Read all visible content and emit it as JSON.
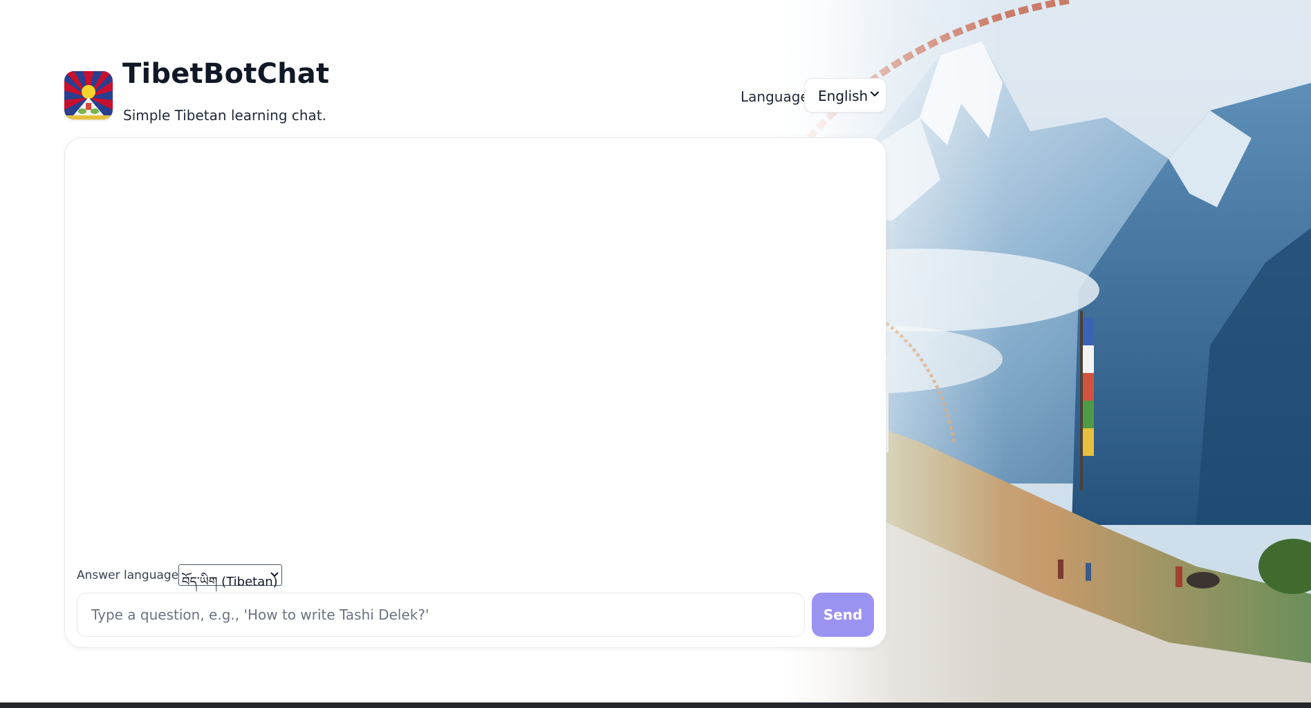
{
  "header": {
    "title": "TibetBotChat",
    "subtitle": "Simple Tibetan learning chat.",
    "logo_icon": "tibetan-flag-icon"
  },
  "language_switch": {
    "label": "Language:",
    "selected": "English"
  },
  "chat": {
    "messages": [],
    "answer_language": {
      "label": "Answer language:",
      "selected": "བོད་ཡིག (Tibetan)"
    },
    "input": {
      "value": "",
      "placeholder": "Type a question, e.g., 'How to write Tashi Delek?'"
    },
    "send_label": "Send"
  },
  "colors": {
    "accent": "#9b93f1",
    "title": "#111827",
    "card_border": "#e6e8ec"
  }
}
